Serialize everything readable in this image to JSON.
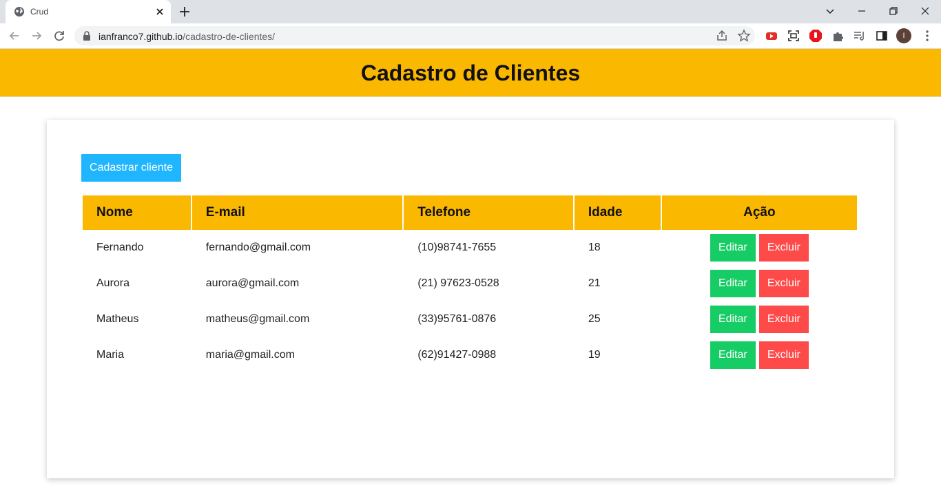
{
  "browser": {
    "tab_title": "Crud",
    "url_domain": "ianfranco7.github.io",
    "url_path": "/cadastro-de-clientes/",
    "profile_initial": "I"
  },
  "page": {
    "title": "Cadastro de Clientes",
    "new_button": "Cadastrar cliente"
  },
  "table": {
    "headers": [
      "Nome",
      "E-mail",
      "Telefone",
      "Idade",
      "Ação"
    ],
    "edit_label": "Editar",
    "delete_label": "Excluir",
    "rows": [
      {
        "nome": "Fernando",
        "email": "fernando@gmail.com",
        "telefone": "(10)98741-7655",
        "idade": "18"
      },
      {
        "nome": "Aurora",
        "email": "aurora@gmail.com",
        "telefone": "(21) 97623-0528",
        "idade": "21"
      },
      {
        "nome": "Matheus",
        "email": "matheus@gmail.com",
        "telefone": "(33)95761-0876",
        "idade": "25"
      },
      {
        "nome": "Maria",
        "email": "maria@gmail.com",
        "telefone": "(62)91427-0988",
        "idade": "19"
      }
    ]
  },
  "colors": {
    "header_bg": "#fbb800",
    "new_button_bg": "#1fb6ff",
    "edit_bg": "#16cc64",
    "delete_bg": "#ff4a4a"
  }
}
